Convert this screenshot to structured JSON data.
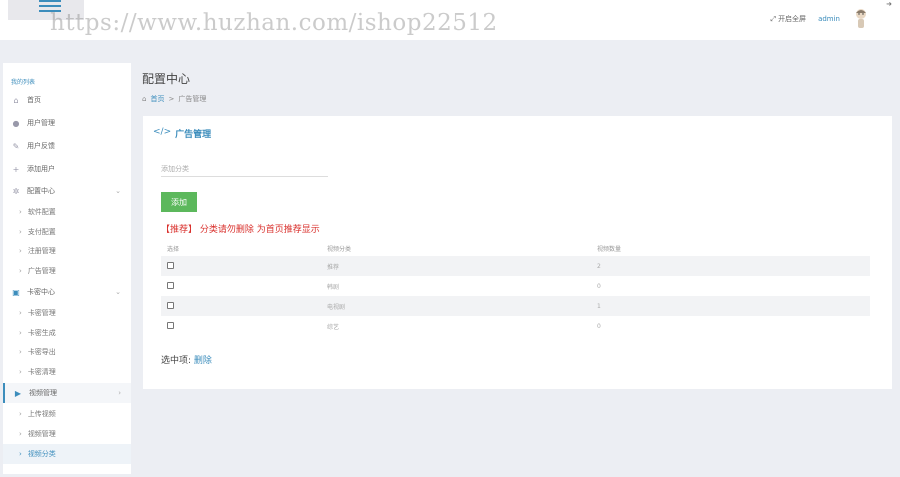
{
  "watermark": "https://www.huzhan.com/ishop22512",
  "topbar": {
    "fullscreen_label": "开启全屏",
    "admin_name": "admin"
  },
  "sidebar": {
    "header": "我的列表",
    "items": [
      {
        "label": "首页",
        "icon": "home-icon"
      },
      {
        "label": "用户管理",
        "icon": "user-icon"
      },
      {
        "label": "用户反馈",
        "icon": "edit-icon"
      },
      {
        "label": "添加用户",
        "icon": "add-user-icon"
      },
      {
        "label": "配置中心",
        "icon": "gear-icon"
      },
      {
        "label": "软件配置"
      },
      {
        "label": "支付配置"
      },
      {
        "label": "注册管理"
      },
      {
        "label": "广告管理"
      },
      {
        "label": "卡密中心",
        "icon": "v-icon"
      },
      {
        "label": "卡密管理"
      },
      {
        "label": "卡密生成"
      },
      {
        "label": "卡密导出"
      },
      {
        "label": "卡密清理"
      },
      {
        "label": "视频管理",
        "icon": "play-icon"
      },
      {
        "label": "上传视频"
      },
      {
        "label": "视频管理"
      },
      {
        "label": "视频分类"
      }
    ]
  },
  "page": {
    "title": "配置中心",
    "breadcrumb_home": "首页",
    "breadcrumb_current": "广告管理"
  },
  "panel": {
    "title": "广告管理",
    "input_placeholder": "添加分类",
    "add_button": "添加",
    "notice": "【推荐】 分类请勿删除 为首页推荐显示",
    "columns": [
      "选择",
      "视频分类",
      "视频数量"
    ],
    "rows": [
      {
        "name": "推荐",
        "count": "2"
      },
      {
        "name": "韩剧",
        "count": "0"
      },
      {
        "name": "电视剧",
        "count": "1"
      },
      {
        "name": "综艺",
        "count": "0"
      }
    ],
    "selected_label": "选中项:",
    "delete_label": "删除"
  }
}
